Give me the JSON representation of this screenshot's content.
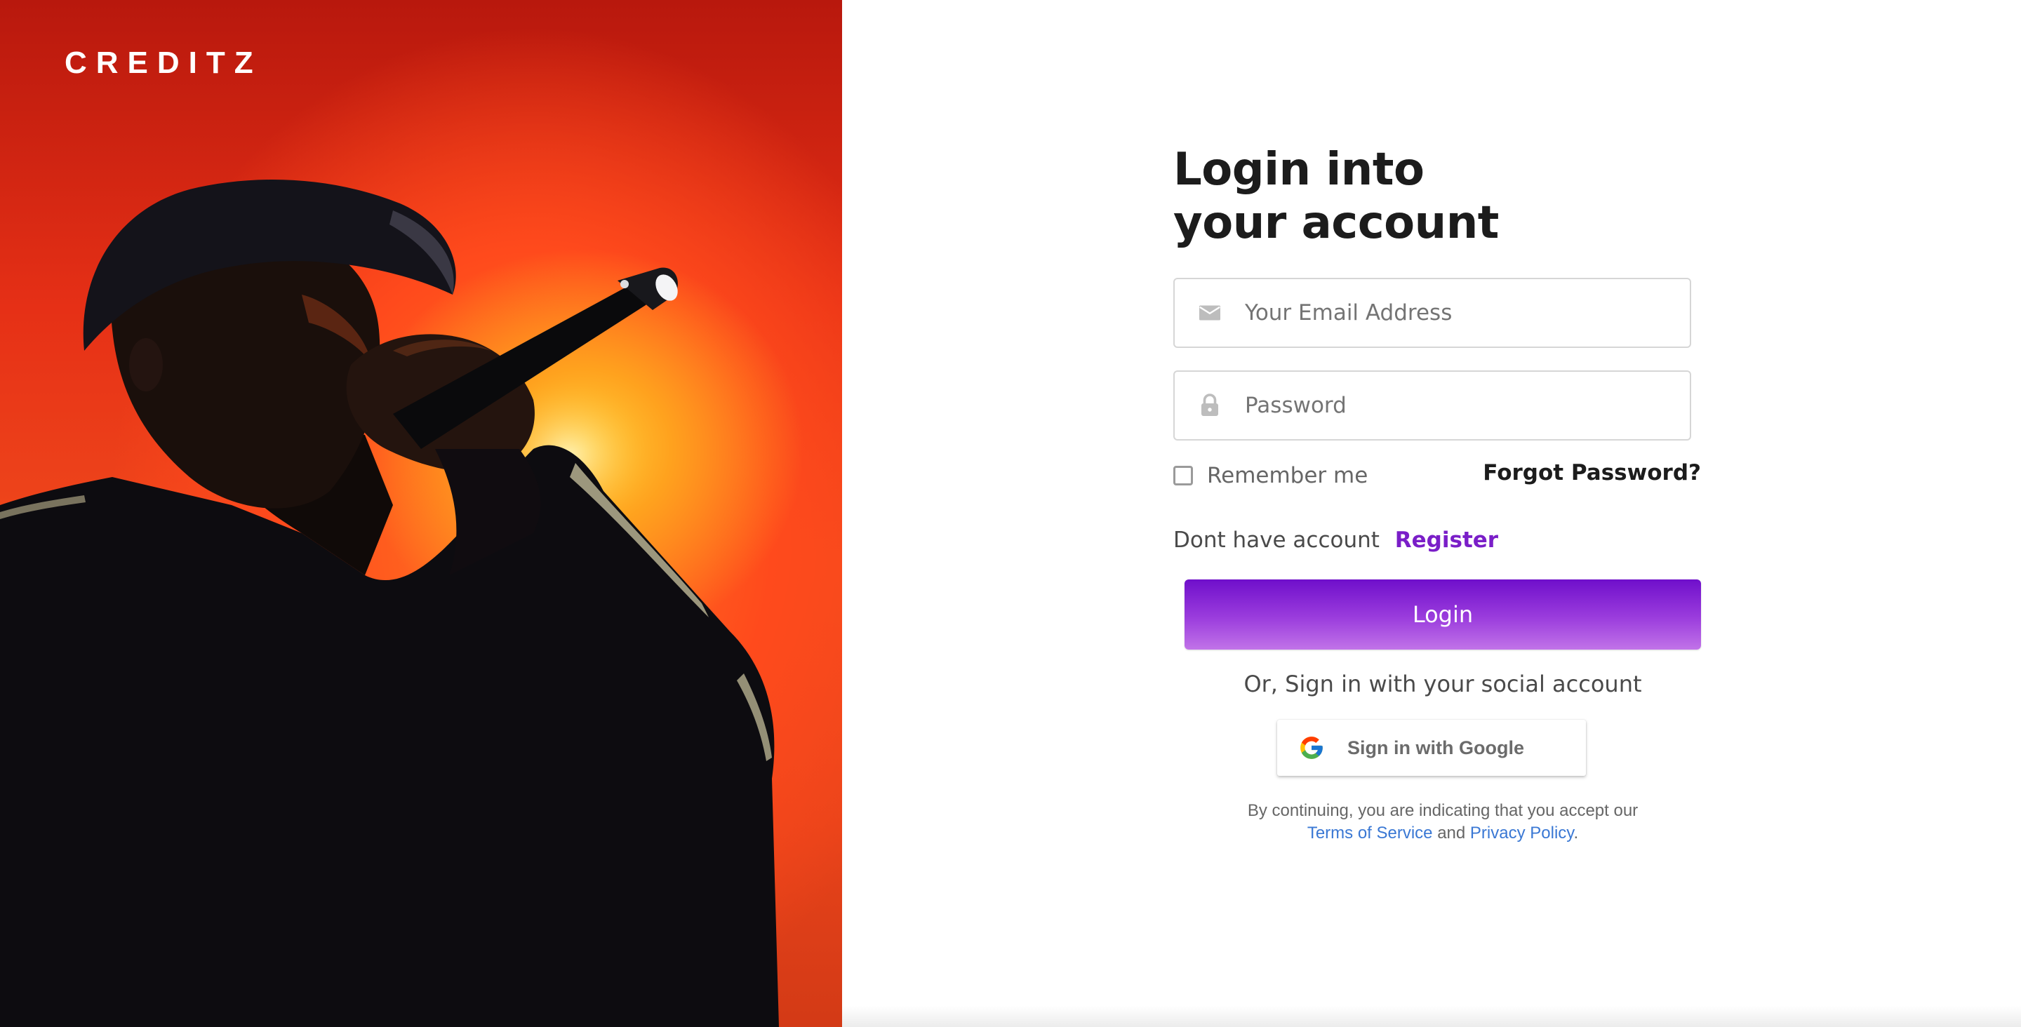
{
  "brand": {
    "logo_text": "CREDITZ"
  },
  "colors": {
    "accent": "#7a1ec8",
    "link": "#3a78d4",
    "hero_red": "#e63016"
  },
  "hero": {
    "image": "performer-with-microphone-on-red-background"
  },
  "login": {
    "title_line1": "Login into",
    "title_line2": "your account",
    "email": {
      "placeholder": "Your Email Address",
      "value": "",
      "icon": "mail-icon"
    },
    "password": {
      "placeholder": "Password",
      "value": "",
      "icon": "lock-icon"
    },
    "remember_label": "Remember me",
    "remember_checked": false,
    "forgot_label": "Forgot Password?",
    "no_account_text": "Dont have account",
    "register_label": "Register",
    "login_button": "Login",
    "social_text": "Or, Sign in with your social account",
    "google_button": "Sign in with Google",
    "legal_text": "By continuing, you are indicating that you accept our",
    "terms_label": "Terms of Service",
    "and_text": "and",
    "privacy_label": "Privacy Policy",
    "period": "."
  }
}
